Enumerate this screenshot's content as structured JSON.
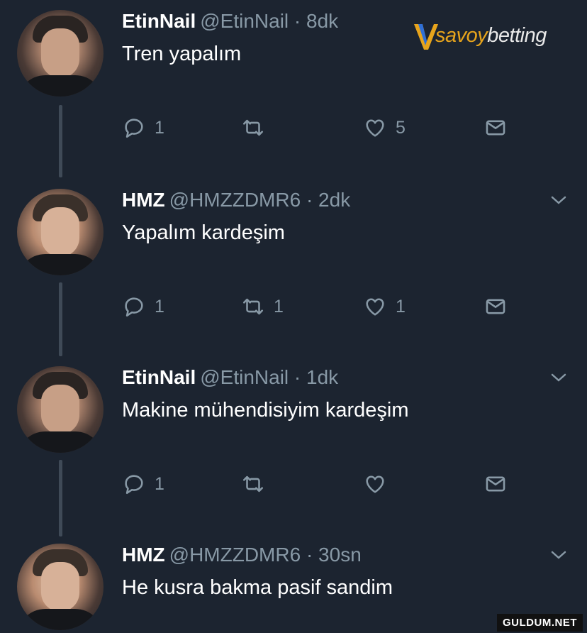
{
  "brand": {
    "name_prefix": "savoy",
    "name_suffix": "betting"
  },
  "watermark": "GULDUM.NET",
  "colors": {
    "background": "#1c2430",
    "muted": "#8899a6",
    "accent": "#e7a41c"
  },
  "tweets": [
    {
      "name": "EtinNail",
      "handle": "@EtinNail · 8dk",
      "text": "Tren yapalım",
      "replies": "1",
      "retweets": "",
      "likes": "5"
    },
    {
      "name": "HMZ",
      "handle": "@HMZZDMR6 · 2dk",
      "text": "Yapalım kardeşim",
      "replies": "1",
      "retweets": "1",
      "likes": "1"
    },
    {
      "name": "EtinNail",
      "handle": "@EtinNail · 1dk",
      "text": "Makine mühendisiyim kardeşim",
      "replies": "1",
      "retweets": "",
      "likes": ""
    },
    {
      "name": "HMZ",
      "handle": "@HMZZDMR6 · 30sn",
      "text": "He kusra bakma pasif sandim"
    }
  ]
}
